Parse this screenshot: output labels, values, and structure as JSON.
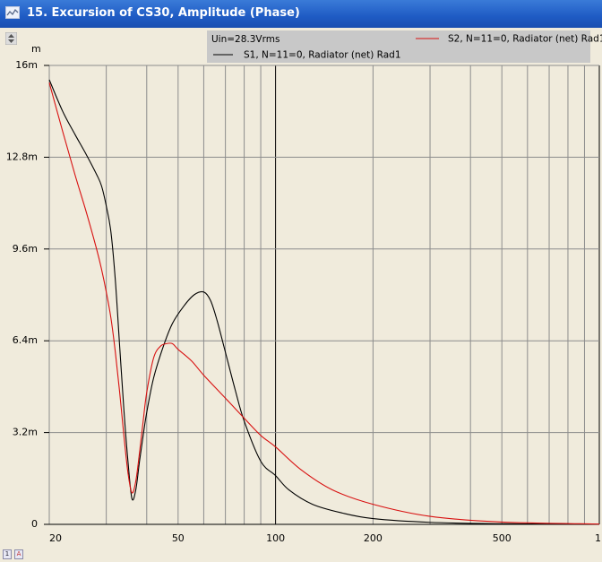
{
  "window": {
    "title": "15. Excursion of CS30, Amplitude (Phase)",
    "title_icon": "chart-window-icon"
  },
  "chart_data": {
    "type": "line",
    "x_scale": "log",
    "y_unit": "m",
    "xlim": [
      20,
      1000
    ],
    "ylim": [
      0,
      0.016
    ],
    "x_ticks": [
      {
        "value": 20,
        "label": "20"
      },
      {
        "value": 50,
        "label": "50"
      },
      {
        "value": 100,
        "label": "100"
      },
      {
        "value": 200,
        "label": "200"
      },
      {
        "value": 500,
        "label": "500"
      },
      {
        "value": 1000,
        "label": "1"
      }
    ],
    "y_ticks": [
      {
        "value": 0,
        "label": "0"
      },
      {
        "value": 0.0032,
        "label": "3.2m"
      },
      {
        "value": 0.0064,
        "label": "6.4m"
      },
      {
        "value": 0.0096,
        "label": "9.6m"
      },
      {
        "value": 0.0128,
        "label": "12.8m"
      },
      {
        "value": 0.016,
        "label": "16m"
      }
    ],
    "grid": true,
    "legend": {
      "placement": "top",
      "header": "Uin=28.3Vrms"
    },
    "series": [
      {
        "name": "S1, N=11=0, Radiator (net) Rad1",
        "color": "#000000",
        "x": [
          20,
          22,
          24,
          26,
          28,
          29,
          30,
          31,
          32,
          33,
          34,
          35,
          36,
          37,
          38,
          39,
          40,
          42,
          45,
          48,
          52,
          56,
          60,
          63,
          66,
          70,
          75,
          80,
          90,
          100,
          110,
          130,
          160,
          200,
          300,
          500,
          1000
        ],
        "y": [
          0.0155,
          0.0144,
          0.0136,
          0.0129,
          0.0122,
          0.0118,
          0.0111,
          0.0102,
          0.0085,
          0.0062,
          0.004,
          0.0022,
          0.0009,
          0.0012,
          0.0022,
          0.0031,
          0.0039,
          0.0051,
          0.0062,
          0.007,
          0.0076,
          0.008,
          0.0081,
          0.0078,
          0.0071,
          0.006,
          0.0047,
          0.0036,
          0.0022,
          0.0017,
          0.0012,
          0.0007,
          0.0004,
          0.0002,
          7e-05,
          2e-05,
          3e-06
        ]
      },
      {
        "name": "S2, N=11=0, Radiator (net) Rad1",
        "color": "#d81010",
        "x": [
          20,
          22,
          24,
          26,
          28,
          29,
          30,
          31,
          32,
          33,
          34,
          35,
          36,
          37,
          38,
          39,
          40,
          42,
          44,
          46,
          48,
          50,
          55,
          60,
          70,
          80,
          90,
          100,
          120,
          150,
          200,
          300,
          500,
          1000
        ],
        "y": [
          0.0154,
          0.0137,
          0.0122,
          0.0109,
          0.0096,
          0.0089,
          0.0081,
          0.0072,
          0.006,
          0.0046,
          0.0031,
          0.0018,
          0.0011,
          0.0015,
          0.0025,
          0.0036,
          0.0046,
          0.0058,
          0.0062,
          0.0063,
          0.0063,
          0.0061,
          0.0057,
          0.0052,
          0.0044,
          0.0037,
          0.0031,
          0.0027,
          0.0019,
          0.0012,
          0.0007,
          0.00028,
          8e-05,
          1e-05
        ]
      }
    ]
  },
  "controls": {
    "foot_left": "1",
    "foot_right": "A"
  }
}
